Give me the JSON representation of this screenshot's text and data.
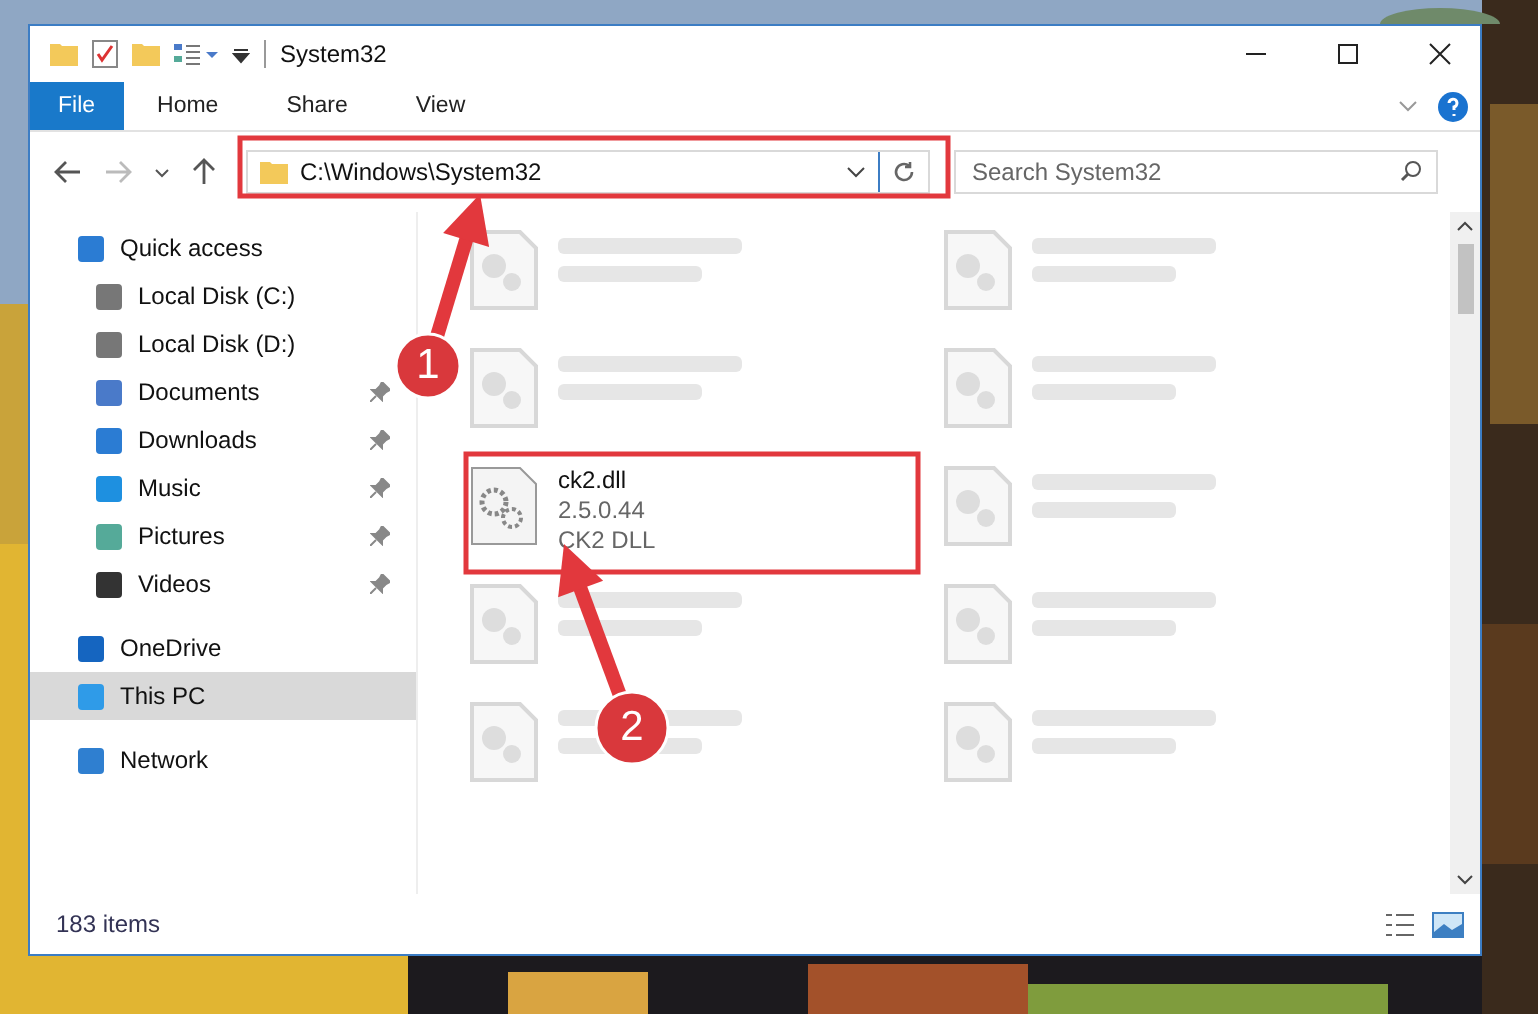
{
  "window": {
    "title": "System32"
  },
  "ribbon": {
    "tabs": [
      {
        "label": "File",
        "kind": "file",
        "selected": false
      },
      {
        "label": "Home",
        "kind": "tab",
        "selected": false
      },
      {
        "label": "Share",
        "kind": "tab",
        "selected": false
      },
      {
        "label": "View",
        "kind": "tab",
        "selected": false
      }
    ]
  },
  "address": {
    "path": "C:\\Windows\\System32"
  },
  "search": {
    "placeholder": "Search System32"
  },
  "sidebar": {
    "items": [
      {
        "label": "Quick access",
        "selected": false,
        "children": [
          {
            "label": "Local Disk (C:)",
            "pinned": false,
            "selected": false
          },
          {
            "label": "Local Disk (D:)",
            "pinned": false,
            "selected": false
          },
          {
            "label": "Documents",
            "pinned": true,
            "selected": false
          },
          {
            "label": "Downloads",
            "pinned": true,
            "selected": false
          },
          {
            "label": "Music",
            "pinned": true,
            "selected": false
          },
          {
            "label": "Pictures",
            "pinned": true,
            "selected": false
          },
          {
            "label": "Videos",
            "pinned": true,
            "selected": false
          }
        ]
      },
      {
        "label": "OneDrive",
        "selected": false
      },
      {
        "label": "This PC",
        "selected": true
      },
      {
        "label": "Network",
        "selected": false
      }
    ]
  },
  "files": [
    {
      "kind": "blurred"
    },
    {
      "kind": "blurred"
    },
    {
      "kind": "blurred"
    },
    {
      "kind": "blurred"
    },
    {
      "kind": "file",
      "name": "ck2.dll",
      "lines": [
        "2.5.0.44",
        "CK2 DLL"
      ]
    },
    {
      "kind": "blurred"
    },
    {
      "kind": "blurred"
    },
    {
      "kind": "blurred"
    },
    {
      "kind": "blurred"
    },
    {
      "kind": "blurred"
    }
  ],
  "status_bar": {
    "count": "183 items"
  },
  "annotations": [
    {
      "number": "1"
    },
    {
      "number": "2"
    }
  ]
}
